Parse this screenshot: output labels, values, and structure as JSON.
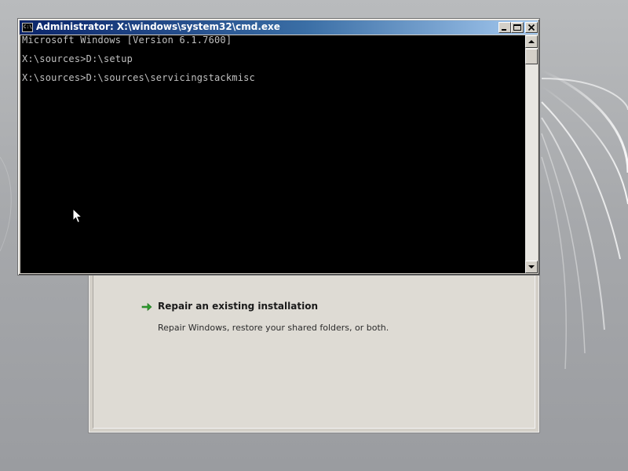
{
  "cmd_window": {
    "title": "Administrator: X:\\windows\\system32\\cmd.exe",
    "icon_text": "C:\\",
    "icon": "cmd-icon",
    "lines": [
      "Microsoft Windows [Version 6.1.7600]",
      "",
      "X:\\sources>D:\\setup",
      "",
      "X:\\sources>D:\\sources\\servicingstackmisc"
    ],
    "colors": {
      "title_bar_start": "#0a246a",
      "title_bar_end": "#a6caf0",
      "console_bg": "#000000",
      "console_text": "#c0c0c0"
    }
  },
  "setup_window": {
    "repair_option": {
      "title": "Repair an existing installation",
      "description": "Repair Windows, restore your shared folders, or both.",
      "icon": "green-arrow-icon",
      "icon_color": "#2e9e2e"
    }
  },
  "desktop": {
    "background": "#a7a9ac"
  }
}
